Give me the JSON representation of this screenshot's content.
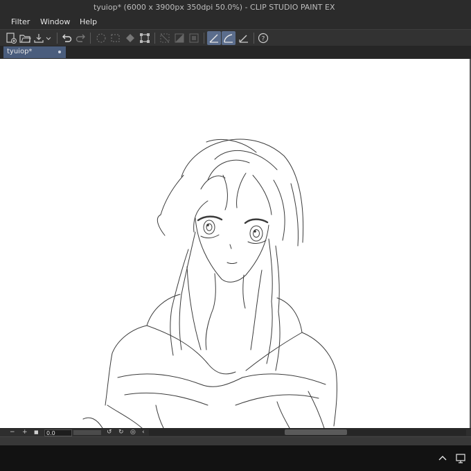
{
  "window": {
    "title": "tyuiop* (6000 x 3900px 350dpi 50.0%)  - CLIP STUDIO PAINT EX"
  },
  "menu": {
    "items": [
      "Filter",
      "Window",
      "Help"
    ]
  },
  "toolbar": {
    "icons": [
      "new-canvas-icon",
      "open-folder-icon",
      "save-icon",
      "dropdown-icon",
      "undo-icon",
      "redo-icon",
      "clear-selection-icon",
      "select-all-icon",
      "fill-icon",
      "transform-icon",
      "show-selection-icon",
      "invert-selection-icon",
      "snap-icon",
      "snap-ruler-icon",
      "snap-special-ruler-icon",
      "snap-grid-icon",
      "help-icon"
    ]
  },
  "document_tab": {
    "label": "tyuiop*"
  },
  "statusbar": {
    "zoom_value": "0.0"
  },
  "colors": {
    "chrome_dark": "#2b2b2b",
    "accent_active": "#5b6d8c",
    "canvas": "#ffffff",
    "line_art": "#3a3a3a"
  }
}
